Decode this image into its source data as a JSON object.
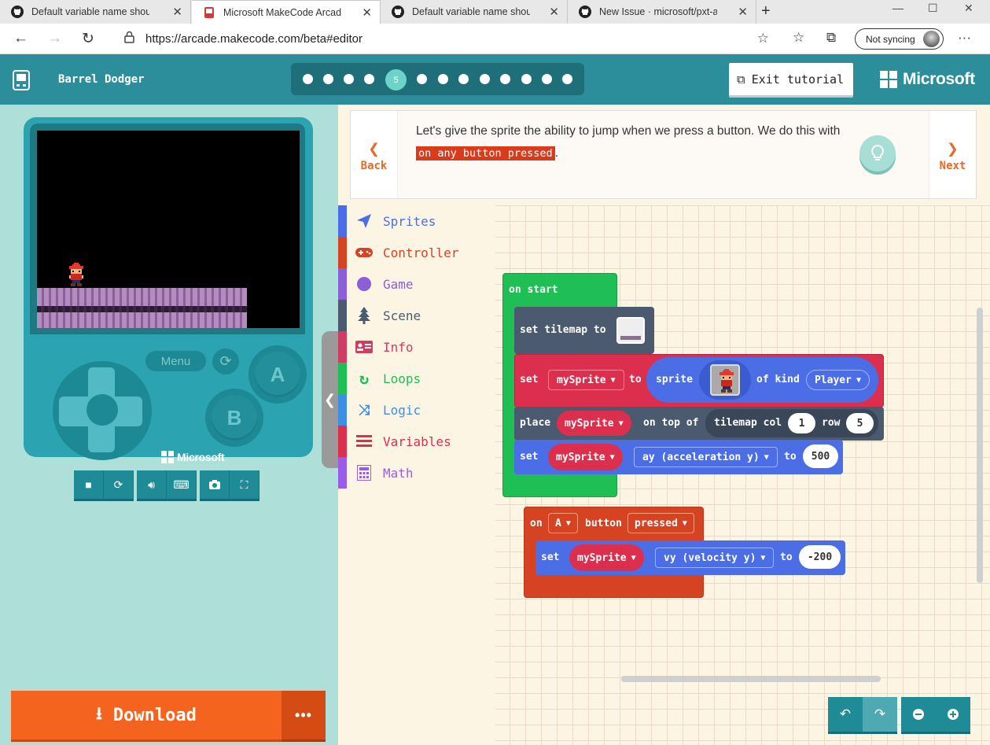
{
  "browser": {
    "tabs": [
      {
        "title": "Default variable name should sh",
        "icon": "github-icon"
      },
      {
        "title": "Microsoft MakeCode Arcade",
        "icon": "makecode-icon"
      },
      {
        "title": "Default variable name should sh",
        "icon": "github-icon"
      },
      {
        "title": "New Issue · microsoft/pxt-arcade",
        "icon": "github-icon"
      }
    ],
    "url": "https://arcade.makecode.com/beta#editor",
    "sync_label": "Not syncing"
  },
  "app": {
    "title": "Barrel Dodger",
    "current_step": "5",
    "exit_label": "Exit tutorial",
    "brand": "Microsoft"
  },
  "tutorial": {
    "back_label": "Back",
    "next_label": "Next",
    "text_before": "Let's give the sprite the ability to jump when we press a button. We do this with ",
    "highlight": "on any button pressed",
    "text_after": "."
  },
  "simulator": {
    "menu_label": "Menu",
    "a_label": "A",
    "b_label": "B",
    "brand": "Microsoft",
    "download_label": "Download",
    "more_label": "•••"
  },
  "toolbox": {
    "categories": [
      {
        "label": "Sprites",
        "color": "#4b6ee6",
        "icon": "paper-plane-icon"
      },
      {
        "label": "Controller",
        "color": "#d54322",
        "icon": "gamepad-icon"
      },
      {
        "label": "Game",
        "color": "#8b5fd8",
        "icon": "circle-icon"
      },
      {
        "label": "Scene",
        "color": "#4b5a6e",
        "icon": "tree-icon"
      },
      {
        "label": "Info",
        "color": "#cf3d63",
        "icon": "id-card-icon"
      },
      {
        "label": "Loops",
        "color": "#20bf55",
        "icon": "loop-icon"
      },
      {
        "label": "Logic",
        "color": "#3d8fe6",
        "icon": "shuffle-icon"
      },
      {
        "label": "Variables",
        "color": "#dc2f4e",
        "icon": "list-icon"
      },
      {
        "label": "Math",
        "color": "#9a5ce8",
        "icon": "calculator-icon"
      }
    ]
  },
  "blocks": {
    "on_start": "on start",
    "set_tilemap": "set tilemap to",
    "set_label": "set",
    "var_name": "mySprite",
    "to_label": "to",
    "sprite_label": "sprite",
    "of_kind": "of kind",
    "kind_value": "Player",
    "place_label": "place",
    "on_top_of": "on top of",
    "tilemap_col": "tilemap col",
    "col_value": "1",
    "row_label": "row",
    "row_value": "5",
    "ay_prop": "ay (acceleration y)",
    "ay_value": "500",
    "on_label": "on",
    "button_key": "A",
    "button_label": "button",
    "pressed_label": "pressed",
    "vy_prop": "vy (velocity y)",
    "vy_value": "-200"
  }
}
